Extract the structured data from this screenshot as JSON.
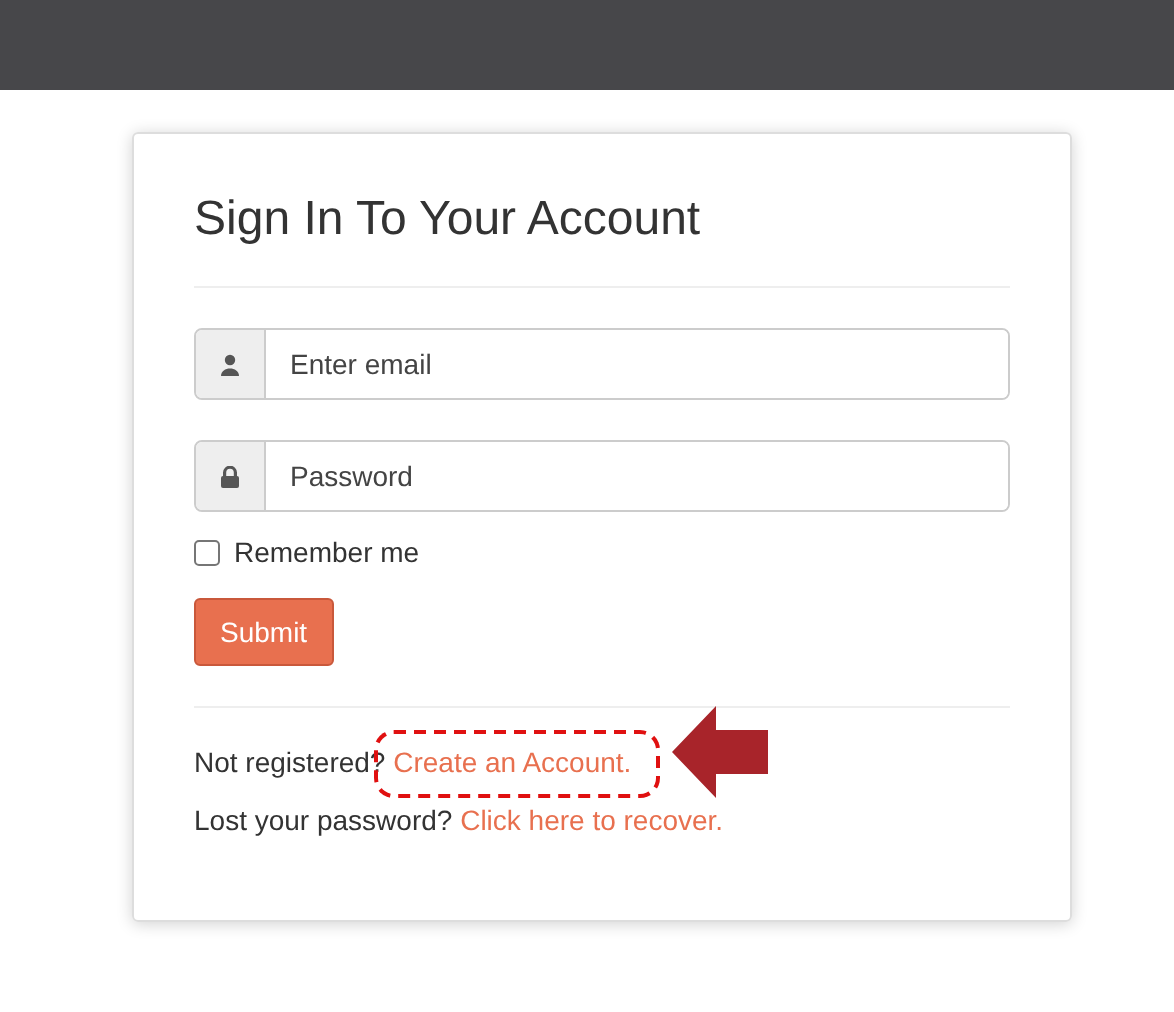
{
  "title": "Sign In To Your Account",
  "fields": [
    {
      "kind": "user",
      "placeholder": "Enter email"
    },
    {
      "kind": "lock",
      "placeholder": "Password"
    }
  ],
  "remember": {
    "label": "Remember me",
    "checked": false
  },
  "submit": "Submit",
  "links": [
    {
      "text": "Not registered?",
      "link": "Create an Account.",
      "highlighted": true
    },
    {
      "text": "Lost your password?",
      "link": "Click here to recover.",
      "highlighted": false
    }
  ]
}
